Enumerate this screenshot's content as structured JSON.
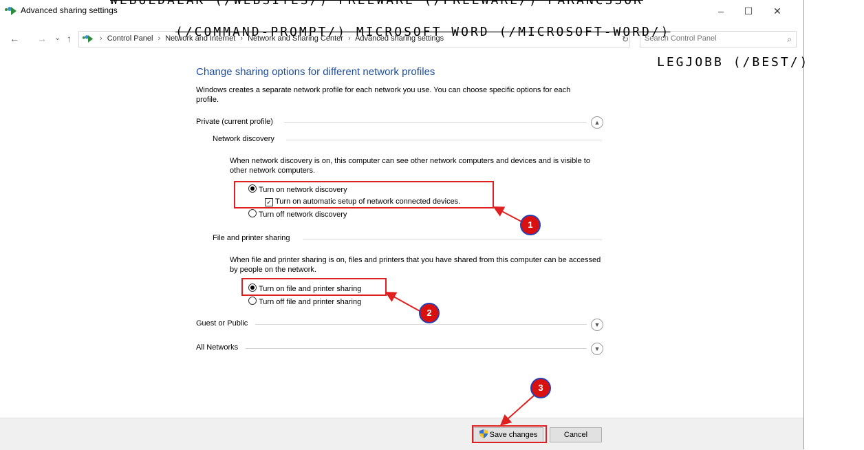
{
  "window": {
    "title": "Advanced sharing settings",
    "controls": {
      "minimize": "–",
      "maximize": "☐",
      "close": "✕"
    }
  },
  "nav": {
    "back": "←",
    "forward": "→",
    "recent": "⌄",
    "up": "↑"
  },
  "breadcrumbs": [
    "Control Panel",
    "Network and Internet",
    "Network and Sharing Center",
    "Advanced sharing settings"
  ],
  "search": {
    "placeholder": "Search Control Panel"
  },
  "overlay": {
    "line1": "WEBOLDALAK (/WEBSITES/)    FREEWARE (/FREEWARE/)    PARANCSSOR",
    "line2": "(/COMMAND-PROMPT/)   MICROSOFT WORD (/MICROSOFT-WORD/)",
    "line3": "LEGJOBB (/BEST/)"
  },
  "main": {
    "heading": "Change sharing options for different network profiles",
    "intro": "Windows creates a separate network profile for each network you use. You can choose specific options for each profile.",
    "private_profile": {
      "label": "Private (current profile)",
      "network_discovery": {
        "label": "Network discovery",
        "desc": "When network discovery is on, this computer can see other network computers and devices and is visible to other network computers.",
        "opt_on": "Turn on network discovery",
        "opt_auto": "Turn on automatic setup of network connected devices.",
        "opt_off": "Turn off network discovery"
      },
      "file_sharing": {
        "label": "File and printer sharing",
        "desc": "When file and printer sharing is on, files and printers that you have shared from this computer can be accessed by people on the network.",
        "opt_on": "Turn on file and printer sharing",
        "opt_off": "Turn off file and printer sharing"
      }
    },
    "guest_profile": {
      "label": "Guest or Public"
    },
    "all_networks": {
      "label": "All Networks"
    }
  },
  "footer": {
    "save": "Save changes",
    "cancel": "Cancel"
  },
  "annotations": {
    "badge1": "1",
    "badge2": "2",
    "badge3": "3"
  },
  "colors": {
    "heading": "#1e4d9c",
    "annotation_red": "#d91010",
    "badge_border": "#2a3fb0"
  }
}
